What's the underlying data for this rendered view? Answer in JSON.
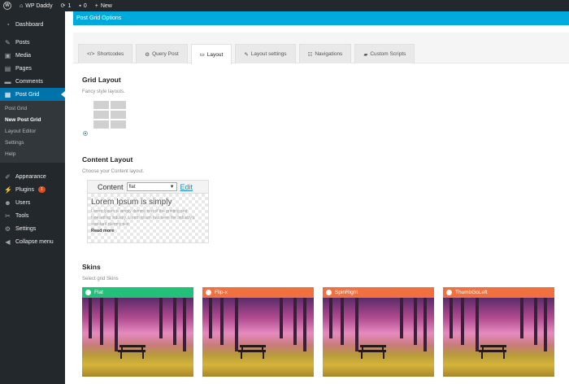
{
  "adminbar": {
    "site": "WP Daddy",
    "updates_count": "1",
    "comments_count": "0",
    "new_label": "New"
  },
  "sidebar": {
    "items": [
      {
        "label": "Dashboard",
        "icon": "dashboard-icon"
      },
      {
        "label": "Posts",
        "icon": "pin-icon"
      },
      {
        "label": "Media",
        "icon": "media-icon"
      },
      {
        "label": "Pages",
        "icon": "pages-icon"
      },
      {
        "label": "Comments",
        "icon": "comment-icon"
      },
      {
        "label": "Post Grid",
        "icon": "post-grid-icon"
      },
      {
        "label": "Appearance",
        "icon": "brush-icon"
      },
      {
        "label": "Plugins",
        "icon": "plugin-icon",
        "badge": "1"
      },
      {
        "label": "Users",
        "icon": "users-icon"
      },
      {
        "label": "Tools",
        "icon": "wrench-icon"
      },
      {
        "label": "Settings",
        "icon": "settings-icon"
      },
      {
        "label": "Collapse menu",
        "icon": "collapse-icon"
      }
    ],
    "submenu": [
      "Post Grid",
      "New Post Grid",
      "Layout Editor",
      "Settings",
      "Help"
    ]
  },
  "header": {
    "title": "Post Grid Options"
  },
  "tabs": [
    {
      "label": "Shortcodes",
      "icon": "code-icon"
    },
    {
      "label": "Query Post",
      "icon": "cogs-icon"
    },
    {
      "label": "Layout",
      "icon": "layout-icon"
    },
    {
      "label": "Layout settings",
      "icon": "pencil-icon"
    },
    {
      "label": "Navigations",
      "icon": "sliders-icon"
    },
    {
      "label": "Custom Scripts",
      "icon": "paint-icon"
    }
  ],
  "grid_layout": {
    "title": "Grid Layout",
    "desc": "Fancy style layouts."
  },
  "content_layout": {
    "title": "Content Layout",
    "desc": "Choose your Content layout.",
    "box_label": "Content",
    "select_value": "flat",
    "edit_label": "Edit",
    "preview_title": "Lorem Ipsum is simply",
    "preview_text": "Lorem Ipsum is simply dummy text of the printing and typesetting industry. Lorem Ipsum has been the industry's standard dummy text",
    "read_more": "Read more"
  },
  "skins": {
    "title": "Skins",
    "desc": "Select grid Skins",
    "items": [
      {
        "label": "Flat",
        "color": "#23c07a"
      },
      {
        "label": "Flip-x",
        "color": "#f0703f"
      },
      {
        "label": "SpinRight",
        "color": "#f0703f"
      },
      {
        "label": "ThumbGoLeft",
        "color": "#f0703f"
      }
    ]
  }
}
